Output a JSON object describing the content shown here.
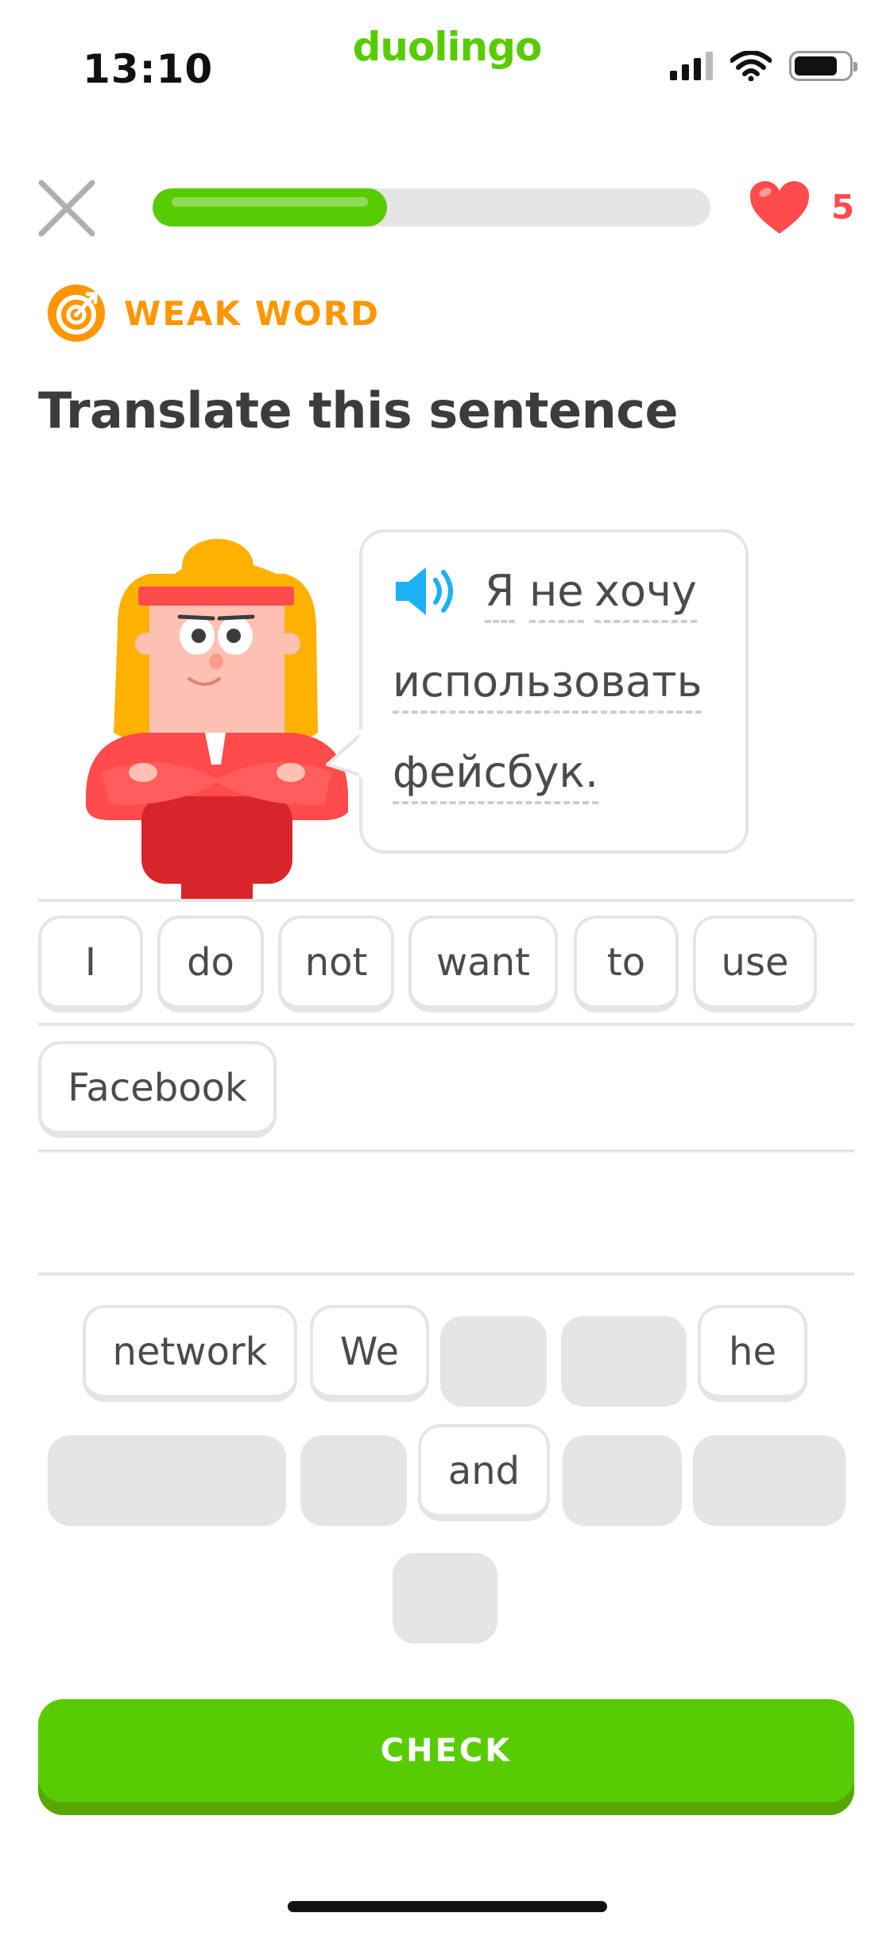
{
  "status_bar": {
    "time": "13:10",
    "brand": "duolingo"
  },
  "top_bar": {
    "progress": 0.42,
    "hearts": "5"
  },
  "badge": {
    "label": "WEAK WORD"
  },
  "prompt": {
    "title": "Translate this sentence"
  },
  "sentence": [
    "Я",
    "не",
    "хочу",
    "использовать",
    "фейсбук."
  ],
  "answer": {
    "chips": [
      "I",
      "do",
      "not",
      "want",
      "to",
      "use",
      "Facebook"
    ]
  },
  "bank": {
    "chips": [
      "network",
      "We",
      "he",
      "and"
    ]
  },
  "actions": {
    "check_label": "CHECK"
  },
  "colors": {
    "accent": "#58cc02",
    "heart": "#ff4b4b",
    "badge": "#ff9600",
    "speaker": "#1cb0f6"
  }
}
